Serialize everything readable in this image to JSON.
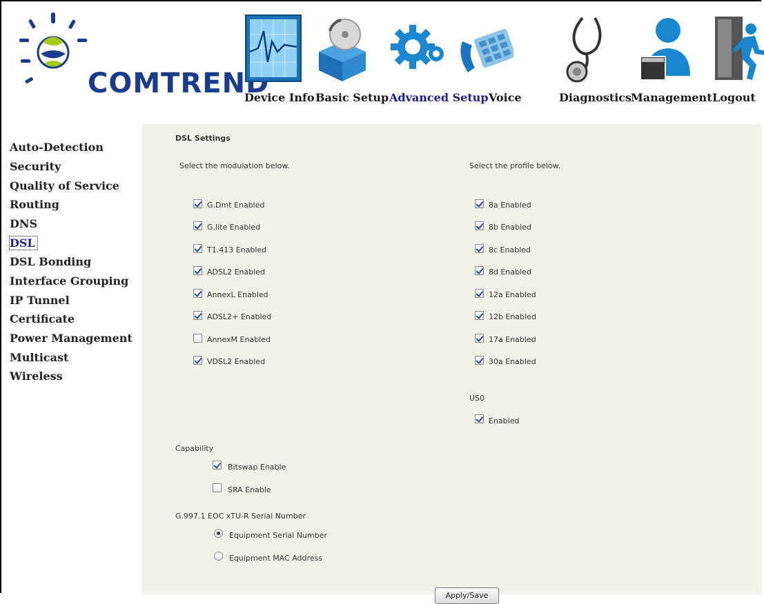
{
  "brand": {
    "name": "COMTREND",
    "color": "#1a3c8c"
  },
  "nav": [
    {
      "label": "Device Info",
      "icon": "device-info-chart-icon"
    },
    {
      "label": "Basic Setup",
      "icon": "basic-setup-box-icon"
    },
    {
      "label": "Advanced Setup",
      "icon": "advanced-setup-gears-icon",
      "active": true
    },
    {
      "label": "Voice",
      "icon": "voice-phone-icon"
    },
    {
      "label": "Diagnostics",
      "icon": "diagnostics-stethoscope-icon"
    },
    {
      "label": "Management",
      "icon": "management-user-icon"
    },
    {
      "label": "Logout",
      "icon": "logout-door-icon"
    }
  ],
  "sidebar": [
    "Auto-Detection",
    "Security",
    "Quality of Service",
    "Routing",
    "DNS",
    "DSL",
    "DSL Bonding",
    "Interface Grouping",
    "IP Tunnel",
    "Certificate",
    "Power Management",
    "Multicast",
    "Wireless"
  ],
  "sidebar_active": "DSL",
  "main": {
    "title": "DSL Settings",
    "modulation_prompt": "Select the modulation below.",
    "profile_prompt": "Select the profile below.",
    "modulations": [
      {
        "label": "G.Dmt Enabled",
        "checked": true
      },
      {
        "label": "G.lite Enabled",
        "checked": true
      },
      {
        "label": "T1.413 Enabled",
        "checked": true
      },
      {
        "label": "ADSL2 Enabled",
        "checked": true
      },
      {
        "label": "AnnexL Enabled",
        "checked": true
      },
      {
        "label": "ADSL2+ Enabled",
        "checked": true
      },
      {
        "label": "AnnexM Enabled",
        "checked": false
      },
      {
        "label": "VDSL2 Enabled",
        "checked": true
      }
    ],
    "profiles": [
      {
        "label": "8a Enabled",
        "checked": true
      },
      {
        "label": "8b Enabled",
        "checked": true
      },
      {
        "label": "8c Enabled",
        "checked": true
      },
      {
        "label": "8d Enabled",
        "checked": true
      },
      {
        "label": "12a Enabled",
        "checked": true
      },
      {
        "label": "12b Enabled",
        "checked": true
      },
      {
        "label": "17a Enabled",
        "checked": true
      },
      {
        "label": "30a Enabled",
        "checked": true
      }
    ],
    "us0_label": "US0",
    "us0": {
      "label": "Enabled",
      "checked": true
    },
    "capability_label": "Capability",
    "capabilities": [
      {
        "label": "Bitswap Enable",
        "checked": true
      },
      {
        "label": "SRA Enable",
        "checked": false
      }
    ],
    "serial_label": "G.997.1 EOC xTU-R Serial Number",
    "serial_options": [
      {
        "label": "Equipment Serial Number",
        "checked": true
      },
      {
        "label": "Equipment MAC Address",
        "checked": false
      }
    ],
    "apply_label": "Apply/Save"
  }
}
